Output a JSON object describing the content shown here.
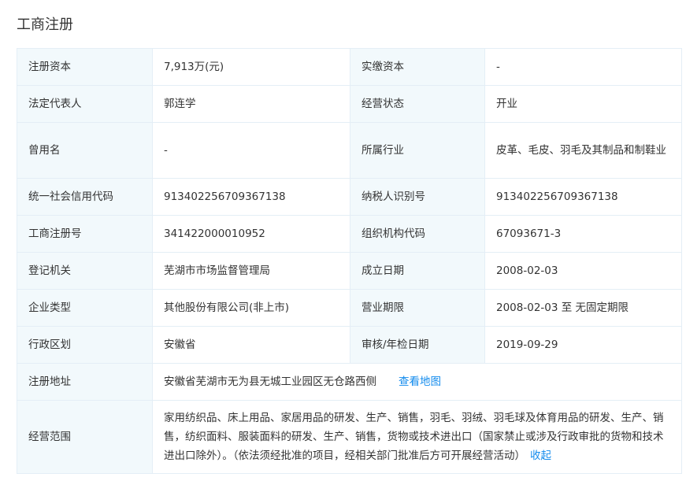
{
  "section": {
    "title": "工商注册"
  },
  "rows": [
    {
      "l1": "注册资本",
      "v1": "7,913万(元)",
      "l2": "实缴资本",
      "v2": "-"
    },
    {
      "l1": "法定代表人",
      "v1": "郭连学",
      "l2": "经营状态",
      "v2": "开业"
    },
    {
      "l1": "曾用名",
      "v1": "-",
      "l2": "所属行业",
      "v2": "皮革、毛皮、羽毛及其制品和制鞋业"
    },
    {
      "l1": "统一社会信用代码",
      "v1": "91340225670936713​8",
      "l2": "纳税人识别号",
      "v2": "913402256709367138"
    },
    {
      "l1": "工商注册号",
      "v1": "341422000010952",
      "l2": "组织机构代码",
      "v2": "67093671-3"
    },
    {
      "l1": "登记机关",
      "v1": "芜湖市市场监督管理局",
      "l2": "成立日期",
      "v2": "2008-02-03"
    },
    {
      "l1": "企业类型",
      "v1": "其他股份有限公司(非上市)",
      "l2": "营业期限",
      "v2": "2008-02-03 至 无固定期限"
    },
    {
      "l1": "行政区划",
      "v1": "安徽省",
      "l2": "审核/年检日期",
      "v2": "2019-09-29"
    }
  ],
  "address": {
    "label": "注册地址",
    "value": "安徽省芜湖市无为县无城工业园区无仓路西侧",
    "map_link": "查看地图"
  },
  "scope": {
    "label": "经营范围",
    "value": "家用纺织品、床上用品、家居用品的研发、生产、销售，羽毛、羽绒、羽毛球及体育用品的研发、生产、销售，纺织面料、服装面料的研发、生产、销售，货物或技术进出口（国家禁止或涉及行政审批的货物和技术进出口除外）。（依法须经批准的项目，经相关部门批准后方可开展经营活动）",
    "collapse_link": "收起"
  },
  "colors": {
    "label_bg": "#f2f9fc",
    "border": "#e4eef6",
    "link": "#128bed",
    "text": "#333333"
  }
}
